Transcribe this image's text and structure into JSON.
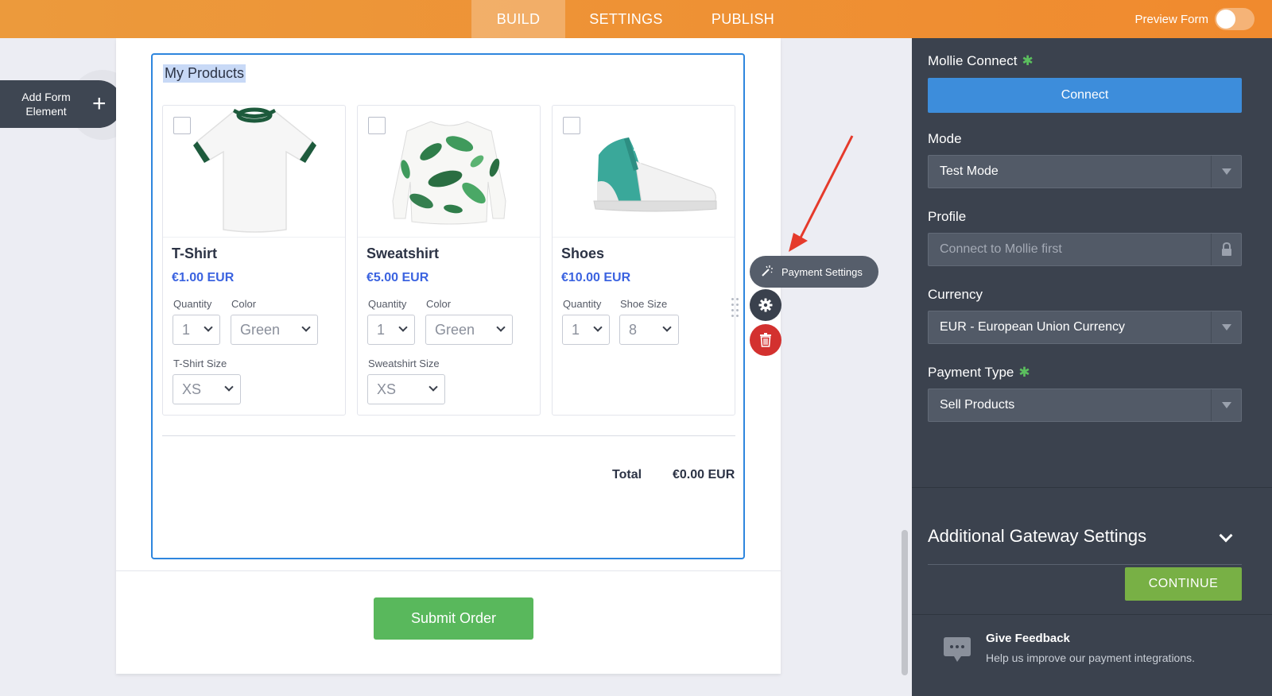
{
  "topbar": {
    "tabs": [
      {
        "label": "BUILD",
        "active": true
      },
      {
        "label": "SETTINGS",
        "active": false
      },
      {
        "label": "PUBLISH",
        "active": false
      }
    ],
    "preview_label": "Preview Form",
    "preview_enabled": false,
    "accent_color": "#f08a2e"
  },
  "add_element": {
    "label_line1": "Add Form",
    "label_line2": "Element",
    "icon": "plus-icon"
  },
  "form": {
    "field_title": "My Products",
    "products": [
      {
        "name": "T-Shirt",
        "price": "€1.00 EUR",
        "image": "t-shirt-image",
        "options": [
          {
            "label": "Quantity",
            "value": "1"
          },
          {
            "label": "Color",
            "value": "Green"
          },
          {
            "label": "T-Shirt Size",
            "value": "XS"
          }
        ]
      },
      {
        "name": "Sweatshirt",
        "price": "€5.00 EUR",
        "image": "sweatshirt-image",
        "options": [
          {
            "label": "Quantity",
            "value": "1"
          },
          {
            "label": "Color",
            "value": "Green"
          },
          {
            "label": "Sweatshirt Size",
            "value": "XS"
          }
        ]
      },
      {
        "name": "Shoes",
        "price": "€10.00 EUR",
        "image": "shoes-image",
        "options": [
          {
            "label": "Quantity",
            "value": "1"
          },
          {
            "label": "Shoe Size",
            "value": "8"
          }
        ]
      }
    ],
    "total_label": "Total",
    "total_value": "€0.00 EUR",
    "submit_label": "Submit Order",
    "price_color": "#3b63e0",
    "submit_color": "#59b85c"
  },
  "field_tools": {
    "payment_settings_label": "Payment Settings",
    "icons": [
      "magic-wand-icon",
      "gear-icon",
      "trash-icon",
      "drag-handle-icon"
    ]
  },
  "panel": {
    "mollie_label": "Mollie Connect",
    "connect_button": "Connect",
    "mode_label": "Mode",
    "mode_value": "Test Mode",
    "profile_label": "Profile",
    "profile_value": "Connect to Mollie first",
    "currency_label": "Currency",
    "currency_value": "EUR - European Union Currency",
    "payment_type_label": "Payment Type",
    "payment_type_value": "Sell Products",
    "additional_settings": "Additional Gateway Settings",
    "continue_label": "CONTINUE",
    "feedback_title": "Give Feedback",
    "feedback_subtitle": "Help us improve our payment integrations.",
    "required_mark": "✱",
    "panel_color": "#3b424e",
    "connect_color": "#3d8ddb",
    "continue_color": "#78b045"
  }
}
